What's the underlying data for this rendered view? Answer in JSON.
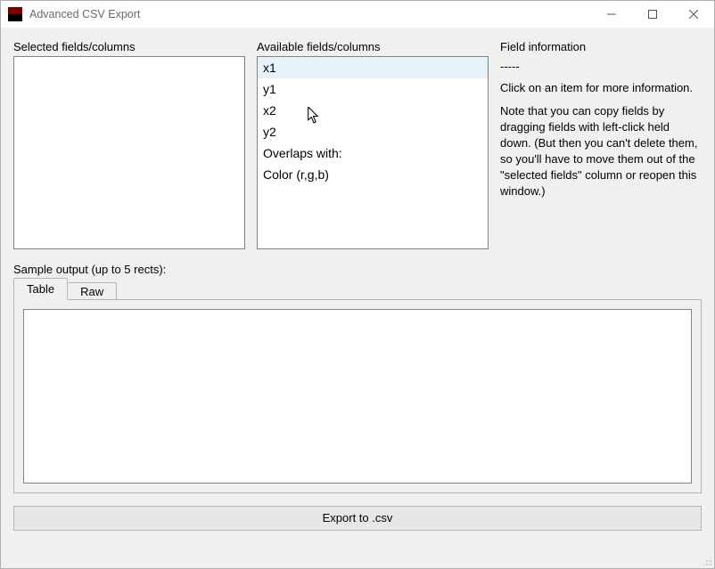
{
  "window": {
    "title": "Advanced CSV Export"
  },
  "labels": {
    "selected": "Selected fields/columns",
    "available": "Available fields/columns",
    "info_header": "Field information",
    "sample": "Sample output (up to 5 rects):"
  },
  "available_fields": [
    "x1",
    "y1",
    "x2",
    "y2",
    "Overlaps with:",
    "Color (r,g,b)"
  ],
  "highlighted_index": 0,
  "selected_fields": [],
  "info": {
    "sep": "-----",
    "line1": "Click on an item for more information.",
    "line2": "Note that you can copy fields by dragging fields with left-click held down. (But then you can't delete them, so you'll have to move them out of the \"selected fields\" column or reopen this window.)"
  },
  "tabs": {
    "table": "Table",
    "raw": "Raw",
    "active": "table"
  },
  "export_button": "Export to .csv"
}
